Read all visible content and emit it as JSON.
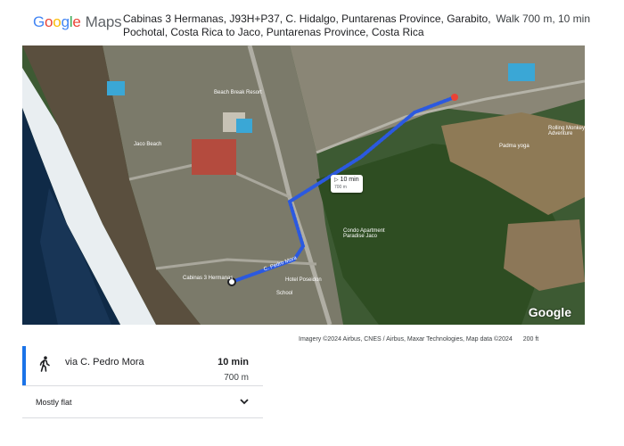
{
  "logo": {
    "g1": "G",
    "o1": "o",
    "o2": "o",
    "g2": "g",
    "l": "l",
    "e": "e",
    "maps": "Maps"
  },
  "route_title": "Cabinas 3 Hermanas, J93H+P37, C. Hidalgo, Puntarenas Province, Garabito, Pochotal, Costa Rica to Jaco, Puntarenas Province, Costa Rica",
  "route_summary": "Walk 700 m, 10 min",
  "map": {
    "duration_badge": "10 min",
    "duration_sub": "700 m",
    "watermark": "Google",
    "labels": {
      "street": "C. Pedro Mora",
      "origin": "Cabinas 3 Hermanas",
      "school": "School",
      "hotel": "Hotel Poseidon",
      "beach_club": "Beach Break Resort",
      "beach": "Jaco Beach",
      "condo": "Condo Apartment Paradise Jaco",
      "padma": "Padma yoga",
      "adventure": "Rolling Monkey Adventure"
    }
  },
  "attribution": {
    "text": "Imagery ©2024 Airbus, CNES / Airbus, Maxar Technologies, Map data ©2024",
    "scale": "200 ft"
  },
  "route_option": {
    "via": "via C. Pedro Mora",
    "time": "10 min",
    "distance": "700 m"
  },
  "terrain": "Mostly flat",
  "colors": {
    "accent": "#1a73e8",
    "route_line": "#3b5bdb"
  }
}
